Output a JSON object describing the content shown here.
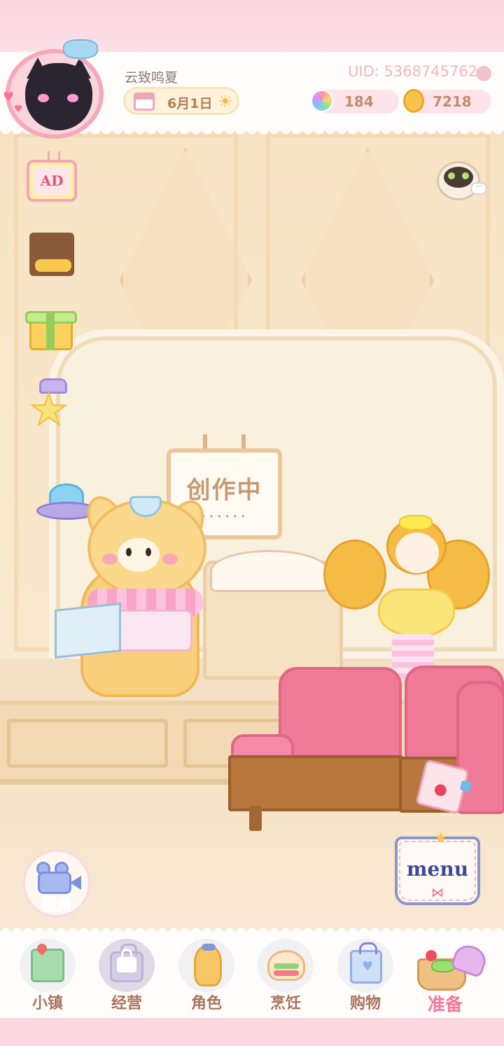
{
  "player": {
    "name": "云致鸣夏",
    "date": "6月1日",
    "uid": "UID: 5368745762"
  },
  "currency": {
    "gems": "184",
    "coins": "7218"
  },
  "scene": {
    "sign_text": "创作中",
    "sign_dots": "......"
  },
  "side_buttons": {
    "ad_label": "AD",
    "view_label": "视角",
    "menu_label": "menu"
  },
  "bottom_nav": [
    {
      "label": "小镇",
      "icon": "map-icon"
    },
    {
      "label": "经营",
      "icon": "shop-bag-icon",
      "locked": true
    },
    {
      "label": "角色",
      "icon": "character-icon"
    },
    {
      "label": "烹饪",
      "icon": "cooking-icon"
    },
    {
      "label": "购物",
      "icon": "shopping-bag-icon"
    },
    {
      "label": "准备",
      "icon": "picnic-basket-icon",
      "active": true
    }
  ],
  "colors": {
    "accent_pink": "#f47997",
    "nav_label": "#a9735e",
    "uid_color": "#f0b8c4"
  }
}
